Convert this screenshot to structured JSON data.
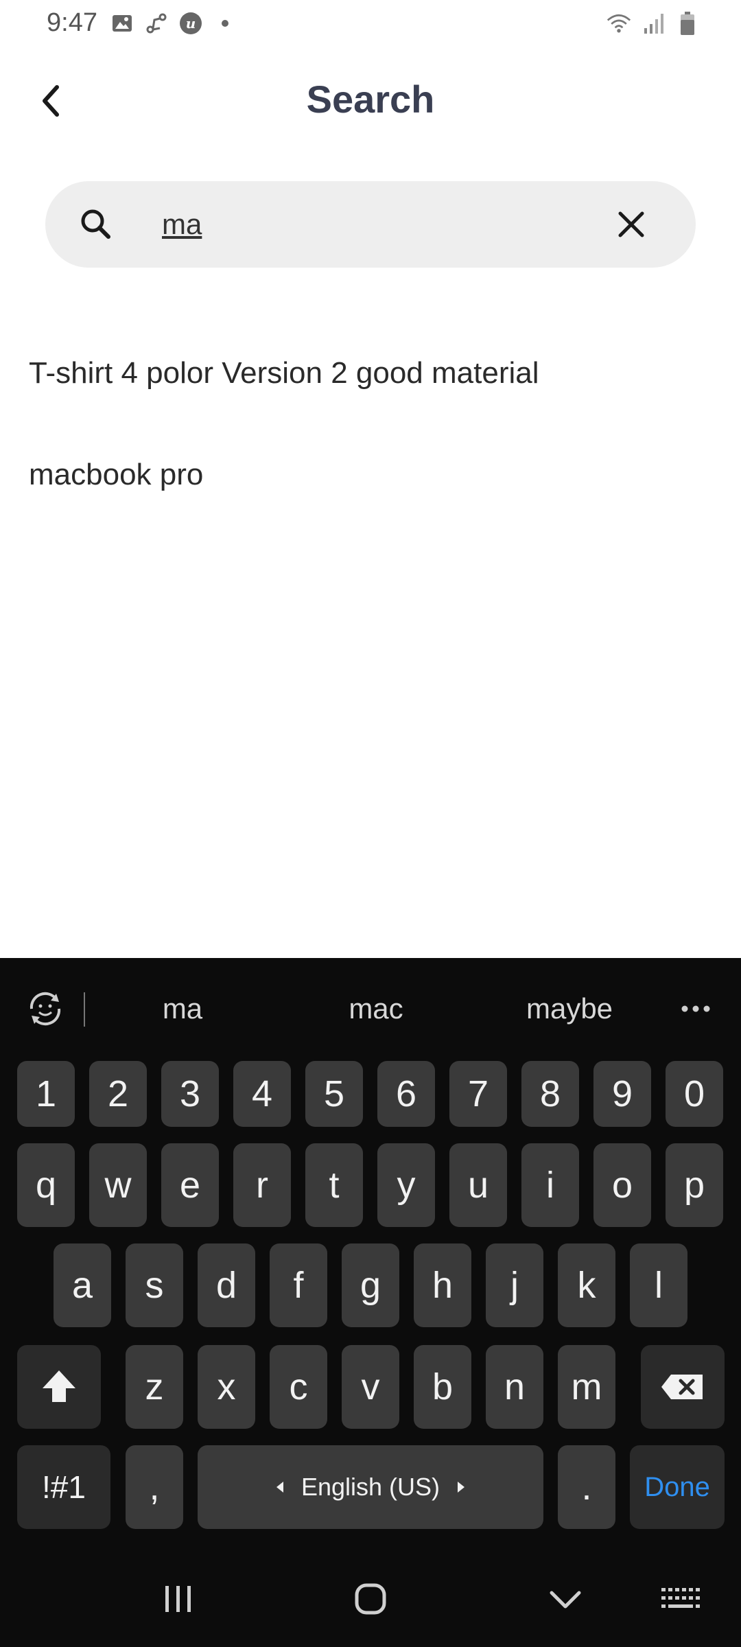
{
  "status_bar": {
    "time": "9:47",
    "left_icons": [
      "image-icon",
      "link-icon",
      "app-u-icon",
      "dot-icon"
    ],
    "right_icons": [
      "wifi-icon",
      "signal-icon",
      "battery-icon"
    ]
  },
  "header": {
    "title": "Search",
    "back_icon": "chevron-left-icon"
  },
  "search": {
    "value": "ma",
    "placeholder": "",
    "search_icon": "search-icon",
    "clear_icon": "close-icon"
  },
  "results": [
    {
      "label": "T-shirt 4 polor Version 2 good material"
    },
    {
      "label": "macbook pro"
    }
  ],
  "keyboard": {
    "suggestions": [
      "ma",
      "mac",
      "maybe"
    ],
    "row_numbers": [
      "1",
      "2",
      "3",
      "4",
      "5",
      "6",
      "7",
      "8",
      "9",
      "0"
    ],
    "row_1": [
      "q",
      "w",
      "e",
      "r",
      "t",
      "y",
      "u",
      "i",
      "o",
      "p"
    ],
    "row_2": [
      "a",
      "s",
      "d",
      "f",
      "g",
      "h",
      "j",
      "k",
      "l"
    ],
    "row_3": [
      "z",
      "x",
      "c",
      "v",
      "b",
      "n",
      "m"
    ],
    "symbols_label": "!#1",
    "comma_label": ",",
    "space_label": "English (US)",
    "period_label": ".",
    "done_label": "Done",
    "accent_color": "#2f8ff0"
  },
  "nav_bar": {
    "icons": [
      "recents-icon",
      "home-icon",
      "hide-keyboard-icon",
      "keyboard-switch-icon"
    ]
  }
}
